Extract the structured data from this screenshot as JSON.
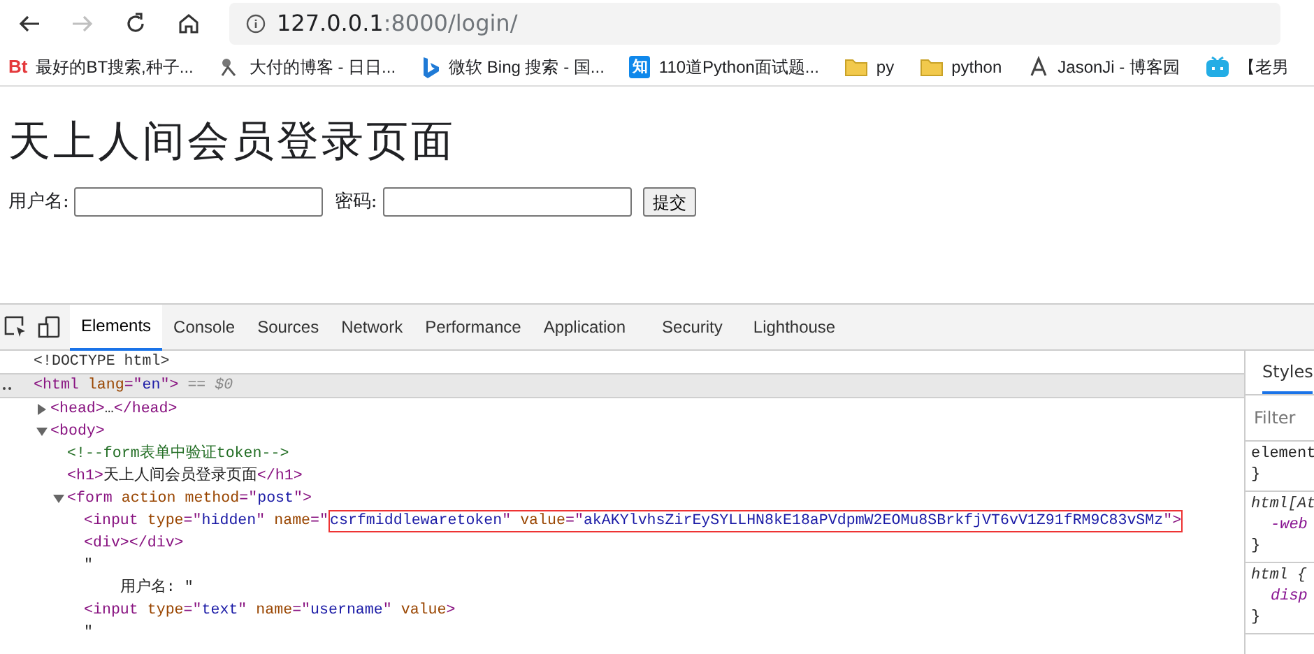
{
  "browser": {
    "nav": [
      {
        "kind": "back",
        "disabled": false
      },
      {
        "kind": "forward",
        "disabled": true
      },
      {
        "kind": "reload",
        "disabled": false
      },
      {
        "kind": "home",
        "disabled": false
      }
    ],
    "address": {
      "host": "127.0.0.1",
      "path": ":8000/login/"
    },
    "bookmarks": [
      {
        "kind": "bt",
        "icon_text": "Bt",
        "label": "最好的BT搜索,种子..."
      },
      {
        "kind": "sketch",
        "label": "大付的博客 - 日日..."
      },
      {
        "kind": "bing",
        "label": "微软 Bing 搜索 - 国..."
      },
      {
        "kind": "zhihu",
        "icon_text": "知",
        "label": "110道Python面试题..."
      },
      {
        "kind": "folder",
        "label": "py"
      },
      {
        "kind": "folder",
        "label": "python"
      },
      {
        "kind": "jason",
        "label": "JasonJi - 博客园"
      },
      {
        "kind": "tv",
        "label": "【老男"
      }
    ]
  },
  "page": {
    "heading": "天上人间会员登录页面",
    "username_label": "用户名:",
    "password_label": "密码:",
    "submit": "提交"
  },
  "devtools": {
    "tabs": [
      {
        "label": "Elements",
        "selected": true
      },
      {
        "label": "Console",
        "selected": false
      },
      {
        "label": "Sources",
        "selected": false
      },
      {
        "label": "Network",
        "selected": false
      },
      {
        "label": "Performance",
        "selected": false
      },
      {
        "label": "Application",
        "selected": false
      },
      {
        "label": "Security",
        "selected": false
      },
      {
        "label": "Lighthouse",
        "selected": false
      }
    ],
    "tree": [
      {
        "selected": false,
        "tokens": [
          {
            "kind": "doctype",
            "text": "<!DOCTYPE html>"
          }
        ]
      },
      {
        "selected": true,
        "tokens": [
          {
            "kind": "tag",
            "text": "<html "
          },
          {
            "kind": "attr",
            "text": "lang"
          },
          {
            "kind": "tag",
            "text": "=\""
          },
          {
            "kind": "value",
            "text": "en"
          },
          {
            "kind": "tag",
            "text": "\">"
          },
          {
            "kind": "hint",
            "text": " == $0"
          }
        ],
        "children": [
          {
            "selected": false,
            "expanded": false,
            "tokens": [
              {
                "kind": "tag",
                "text": "<head>"
              },
              {
                "kind": "text",
                "text": "…"
              },
              {
                "kind": "tag",
                "text": "</head>"
              }
            ]
          },
          {
            "selected": false,
            "expanded": true,
            "tokens": [
              {
                "kind": "tag",
                "text": "<body>"
              }
            ],
            "children": [
              {
                "selected": false,
                "tokens": [
                  {
                    "kind": "comment",
                    "text": "<!--form表单中验证token-->"
                  }
                ]
              },
              {
                "selected": false,
                "tokens": [
                  {
                    "kind": "tag",
                    "text": "<h1>"
                  },
                  {
                    "kind": "text",
                    "text": "天上人间会员登录页面"
                  },
                  {
                    "kind": "tag",
                    "text": "</h1>"
                  }
                ]
              },
              {
                "selected": false,
                "expanded": true,
                "tokens": [
                  {
                    "kind": "tag",
                    "text": "<form "
                  },
                  {
                    "kind": "attr",
                    "text": "action method"
                  },
                  {
                    "kind": "tag",
                    "text": "=\""
                  },
                  {
                    "kind": "value",
                    "text": "post"
                  },
                  {
                    "kind": "tag",
                    "text": "\">"
                  }
                ],
                "children": [
                  {
                    "selected": false,
                    "tokens": [
                      {
                        "kind": "tag",
                        "text": "<input "
                      },
                      {
                        "kind": "attr",
                        "text": "type"
                      },
                      {
                        "kind": "tag",
                        "text": "=\""
                      },
                      {
                        "kind": "value",
                        "text": "hidden"
                      },
                      {
                        "kind": "tag",
                        "text": "\" "
                      },
                      {
                        "kind": "attr",
                        "text": "name"
                      },
                      {
                        "kind": "tag",
                        "text": "=\""
                      }
                    ],
                    "boxed_tokens": [
                      {
                        "kind": "value",
                        "text": "csrfmiddlewaretoken"
                      },
                      {
                        "kind": "tag",
                        "text": "\" "
                      },
                      {
                        "kind": "attr",
                        "text": "value"
                      },
                      {
                        "kind": "tag",
                        "text": "=\""
                      },
                      {
                        "kind": "value",
                        "text": "akAKYlvhsZirEySYLLHN8kE18aPVdpmW2EOMu8SBrkfjVT6vV1Z91fRM9C83vSMz"
                      },
                      {
                        "kind": "tag",
                        "text": "\">"
                      }
                    ]
                  },
                  {
                    "selected": false,
                    "tokens": [
                      {
                        "kind": "tag",
                        "text": "<div></div>"
                      }
                    ]
                  },
                  {
                    "selected": false,
                    "tokens": [
                      {
                        "kind": "text",
                        "text": "\"\n    用户名: \""
                      }
                    ]
                  },
                  {
                    "selected": false,
                    "tokens": [
                      {
                        "kind": "tag",
                        "text": "<input "
                      },
                      {
                        "kind": "attr",
                        "text": "type"
                      },
                      {
                        "kind": "tag",
                        "text": "=\""
                      },
                      {
                        "kind": "value",
                        "text": "text"
                      },
                      {
                        "kind": "tag",
                        "text": "\" "
                      },
                      {
                        "kind": "attr",
                        "text": "name"
                      },
                      {
                        "kind": "tag",
                        "text": "=\""
                      },
                      {
                        "kind": "value",
                        "text": "username"
                      },
                      {
                        "kind": "tag",
                        "text": "\" "
                      },
                      {
                        "kind": "attr",
                        "text": "value"
                      },
                      {
                        "kind": "tag",
                        "text": ">"
                      }
                    ]
                  },
                  {
                    "selected": false,
                    "tokens": [
                      {
                        "kind": "text",
                        "text": "\""
                      }
                    ]
                  }
                ]
              }
            ]
          }
        ]
      }
    ],
    "styles": {
      "tab": "Styles",
      "filter_placeholder": "Filter",
      "rules": [
        {
          "lines": [
            {
              "kind": "selector",
              "text": "element"
            },
            {
              "kind": "brace",
              "text": "}"
            }
          ]
        },
        {
          "lines": [
            {
              "kind": "selector-italic",
              "text": "html[At"
            },
            {
              "kind": "prop",
              "text": "-web"
            },
            {
              "kind": "brace",
              "text": "}"
            }
          ]
        },
        {
          "lines": [
            {
              "kind": "selector-italic",
              "text": "html {"
            },
            {
              "kind": "prop",
              "text": "disp"
            },
            {
              "kind": "brace",
              "text": "}"
            }
          ]
        }
      ]
    }
  }
}
